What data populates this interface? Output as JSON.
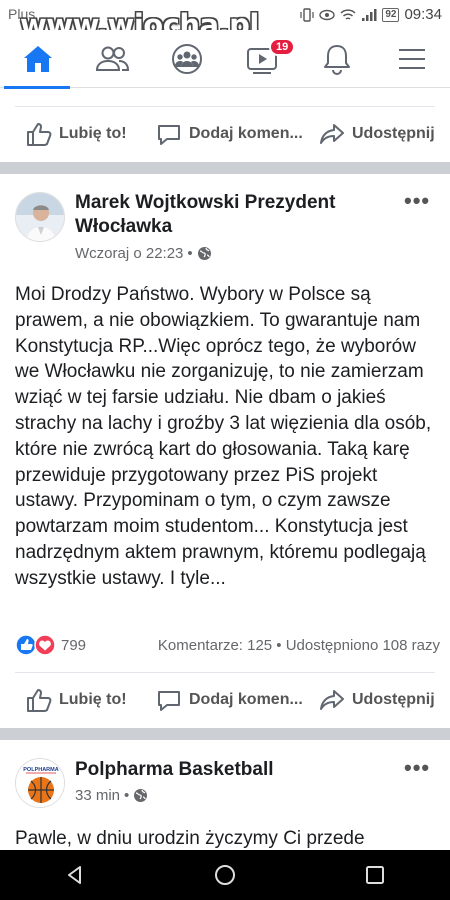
{
  "status_bar": {
    "carrier": "Plus",
    "battery": "92",
    "time": "09:34"
  },
  "watermark": "www.wiocha.pl",
  "nav": {
    "notifications_badge": "19"
  },
  "action_labels": {
    "like": "Lubię to!",
    "comment": "Dodaj komen...",
    "share": "Udostępnij"
  },
  "post": {
    "author": "Marek Wojtkowski Prezydent Włocławka",
    "time": "Wczoraj o 22:23",
    "text": "Moi Drodzy Państwo. Wybory w Polsce są prawem, a nie obowiązkiem. To gwarantuje nam Konstytucja RP...Więc oprócz tego, że wyborów we Włocławku nie zorganizuję, to nie zamierzam wziąć w tej farsie udziału. Nie dbam o jakieś strachy na lachy i groźby 3 lat więzienia dla osób, które nie zwrócą kart do głosowania. Taką karę przewiduje przygotowany przez PiS projekt ustawy. Przypominam o tym, o czym zawsze powtarzam moim studentom... Konstytucja jest nadrzędnym aktem prawnym, któremu podlegają wszystkie ustawy. I tyle...",
    "reaction_count": "799",
    "stats": "Komentarze: 125 • Udostępniono 108 razy"
  },
  "post2": {
    "author": "Polpharma Basketball",
    "avatar_text": "POLPHARMA",
    "time": "33 min",
    "text": "Pawle, w dniu urodzin życzymy Ci przede"
  },
  "colors": {
    "accent": "#1877f2",
    "separator": "#ccd0d5",
    "badge": "#e41e3f",
    "like": "#1877f2",
    "love": "#f33e58"
  }
}
